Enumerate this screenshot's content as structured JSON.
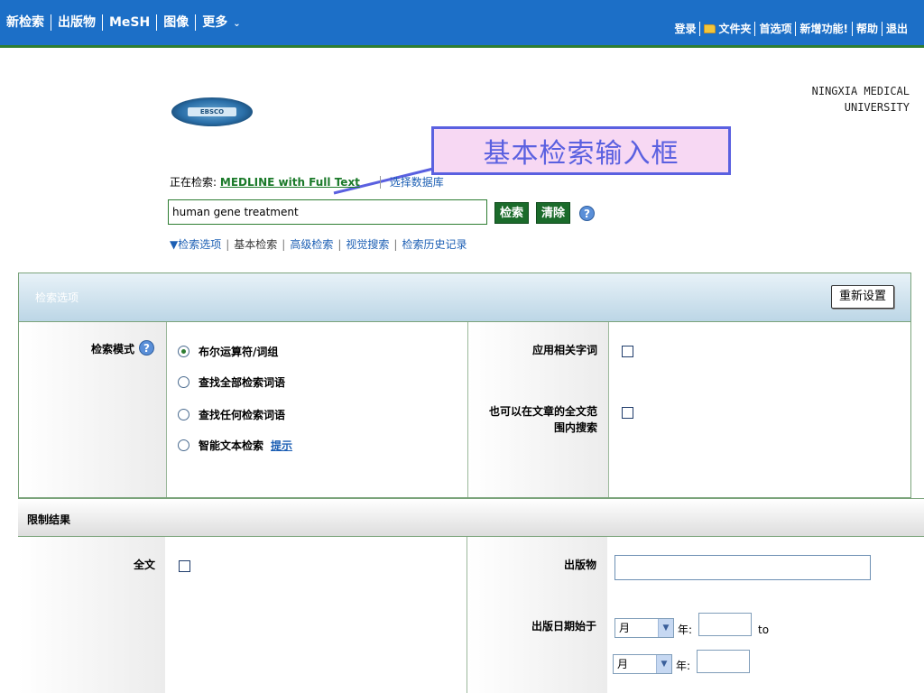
{
  "topnav": {
    "items": [
      "新检索",
      "出版物",
      "MeSH",
      "图像",
      "更多"
    ],
    "more_chevron": "⌄"
  },
  "toplinks": [
    "登录",
    "文件夹",
    "首选项",
    "新增功能!",
    "帮助",
    "退出"
  ],
  "institution": {
    "line1": "NINGXIA MEDICAL",
    "line2": "UNIVERSITY"
  },
  "logo_text": "EBSCO",
  "callout": "基本检索输入框",
  "searching": {
    "label": "正在检索:",
    "database": "MEDLINE with Full Text",
    "choose": "选择数据库"
  },
  "search": {
    "value": "human gene treatment",
    "search_btn": "检索",
    "clear_btn": "清除",
    "help": "?"
  },
  "search_links": {
    "options": "▼检索选项",
    "basic": "基本检索",
    "advanced": "高级检索",
    "visual": "视觉搜索",
    "history": "检索历史记录"
  },
  "panel": {
    "title": "检索选项",
    "reset": "重新设置",
    "mode_label": "检索模式",
    "modes": [
      "布尔运算符/词组",
      "查找全部检索词语",
      "查找任何检索词语",
      "智能文本检索"
    ],
    "hint": "提示",
    "related_words": "应用相关字词",
    "fulltext_search_l1": "也可以在文章的全文范",
    "fulltext_search_l2": "围内搜索"
  },
  "limit": {
    "title": "限制结果",
    "fulltext": "全文",
    "publication": "出版物",
    "pubdate": "出版日期始于",
    "month": "月",
    "year": "年:",
    "to": "to"
  }
}
